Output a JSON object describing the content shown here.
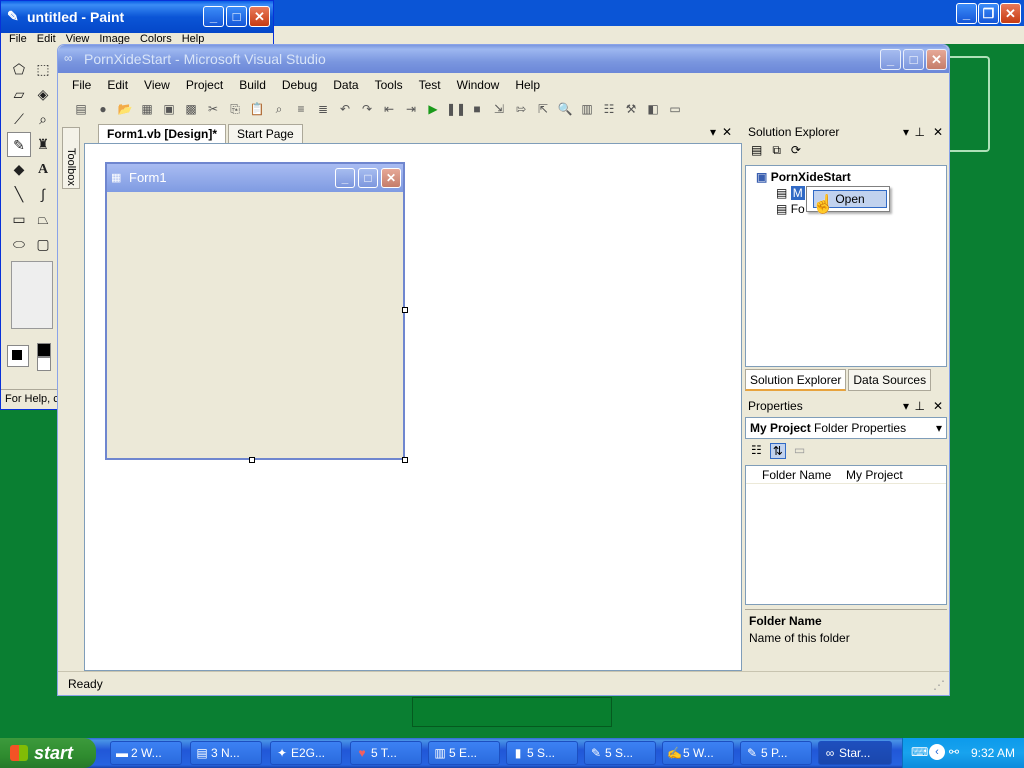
{
  "background_window": {
    "min": "_",
    "max": "❐",
    "close": "✕"
  },
  "paint": {
    "title": "untitled - Paint",
    "menu": [
      "File",
      "Edit",
      "View",
      "Image",
      "Colors",
      "Help"
    ],
    "status": "For Help, c"
  },
  "vs": {
    "title": "PornXideStart - Microsoft Visual Studio",
    "menu": [
      "File",
      "Edit",
      "View",
      "Project",
      "Build",
      "Debug",
      "Data",
      "Tools",
      "Test",
      "Window",
      "Help"
    ],
    "toolbox_label": "Toolbox",
    "tabs": [
      "Form1.vb [Design]*",
      "Start Page"
    ],
    "form": {
      "title": "Form1"
    },
    "solution_explorer": {
      "title": "Solution Explorer",
      "project": "PornXideStart",
      "items": [
        "M",
        "Fo"
      ],
      "context_menu_item": "Open",
      "tabs": [
        "Solution Explorer",
        "Data Sources"
      ]
    },
    "properties": {
      "title": "Properties",
      "selected_object": "My Project",
      "selected_type": "Folder Properties",
      "rows": [
        {
          "name": "Folder Name",
          "value": "My Project"
        }
      ],
      "desc_title": "Folder Name",
      "desc_text": "Name of this folder"
    },
    "status": "Ready"
  },
  "taskbar": {
    "start": "start",
    "tasks": [
      "2 W...",
      "3 N...",
      "E2G...",
      "5 T...",
      "5 E...",
      "5 S...",
      "5 S...",
      "5 W...",
      "5 P...",
      "Star..."
    ],
    "clock": "9:32 AM"
  }
}
